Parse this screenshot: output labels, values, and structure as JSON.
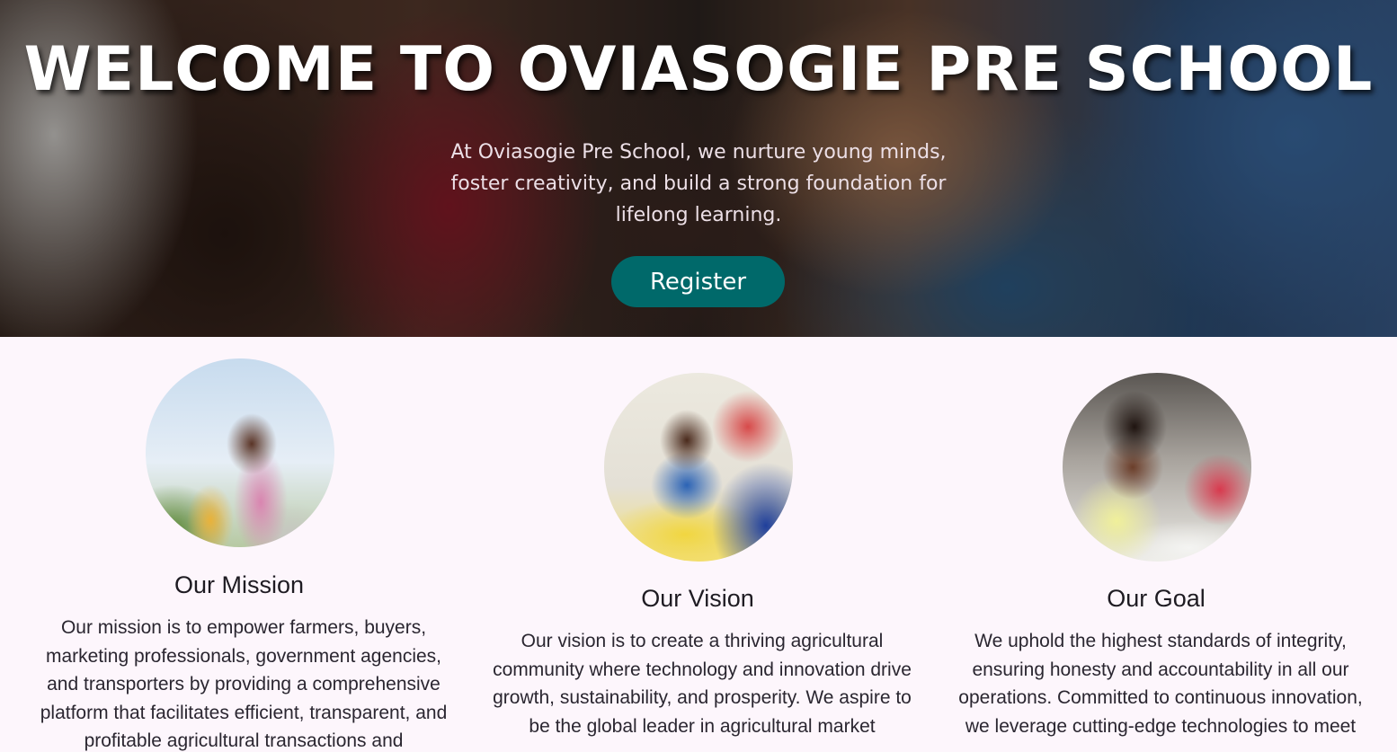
{
  "hero": {
    "title": "WELCOME TO OVIASOGIE PRE SCHOOL",
    "text": "At Oviasogie Pre School, we nurture young minds, foster creativity, and build a strong foundation for lifelong learning.",
    "register_label": "Register",
    "accent_color": "#00696a"
  },
  "cards": [
    {
      "title": "Our Mission",
      "text": "Our mission is to empower farmers, buyers, marketing professionals, government agencies, and transporters by providing a comprehensive platform that facilitates efficient, transparent, and profitable agricultural transactions and",
      "image": "children-cheering-photo"
    },
    {
      "title": "Our Vision",
      "text": "Our vision is to create a thriving agricultural community where technology and innovation drive growth, sustainability, and prosperity. We aspire to be the global leader in agricultural market",
      "image": "boy-smiling-in-classroom-photo"
    },
    {
      "title": "Our Goal",
      "text": "We uphold the highest standards of integrity, ensuring honesty and accountability in all our operations. Committed to continuous innovation, we leverage cutting-edge technologies to meet",
      "image": "girl-writing-at-desk-photo"
    }
  ]
}
